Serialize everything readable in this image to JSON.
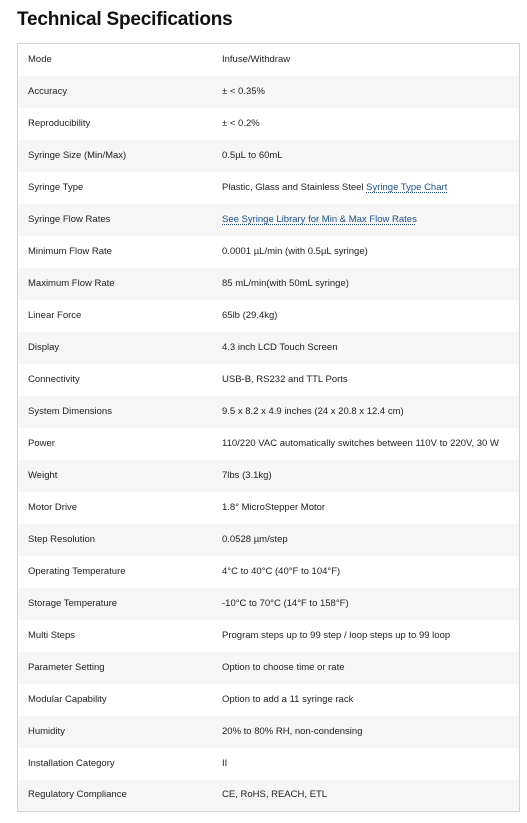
{
  "page": {
    "title": "Technical Specifications"
  },
  "colors": {
    "link": "#1b4f8a",
    "row_alt": "#f6f6f6",
    "border": "#d4d4d4"
  },
  "specs": [
    {
      "label": "Mode",
      "value": "Infuse/Withdraw"
    },
    {
      "label": "Accuracy",
      "value": "± < 0.35%"
    },
    {
      "label": "Reproducibility",
      "value": "± < 0.2%"
    },
    {
      "label": "Syringe Size (Min/Max)",
      "value": "0.5µL to 60mL"
    },
    {
      "label": "Syringe Type",
      "value": "Plastic, Glass and Stainless Steel ",
      "link": "Syringe Type Chart"
    },
    {
      "label": "Syringe Flow Rates",
      "value": "",
      "link": "See Syringe Library for Min & Max Flow Rates"
    },
    {
      "label": "Minimum Flow Rate",
      "value": "0.0001 µL/min (with 0.5µL syringe)"
    },
    {
      "label": "Maximum Flow Rate",
      "value": "85 mL/min(with 50mL syringe)"
    },
    {
      "label": "Linear Force",
      "value": "65lb (29.4kg)"
    },
    {
      "label": "Display",
      "value": "4.3 inch LCD Touch Screen"
    },
    {
      "label": "Connectivity",
      "value": "USB-B, RS232 and TTL Ports"
    },
    {
      "label": "System Dimensions",
      "value": "9.5 x 8.2 x 4.9 inches (24 x 20.8 x 12.4 cm)"
    },
    {
      "label": "Power",
      "value": "110/220 VAC automatically switches between 110V to 220V, 30 W"
    },
    {
      "label": "Weight",
      "value": "7lbs (3.1kg)"
    },
    {
      "label": "Motor Drive",
      "value": "1.8° MicroStepper Motor"
    },
    {
      "label": "Step Resolution",
      "value": "0.0528 µm/step"
    },
    {
      "label": "Operating Temperature",
      "value": "4°C to 40°C (40°F to 104°F)"
    },
    {
      "label": "Storage Temperature",
      "value": "-10°C to 70°C (14°F to 158°F)"
    },
    {
      "label": "Multi Steps",
      "value": "Program steps up to 99 step / loop steps up to 99 loop"
    },
    {
      "label": "Parameter Setting",
      "value": "Option to choose time or rate"
    },
    {
      "label": "Modular Capability",
      "value": "Option to add a 11 syringe rack"
    },
    {
      "label": "Humidity",
      "value": "20% to 80% RH, non-condensing"
    },
    {
      "label": "Installation Category",
      "value": "II"
    },
    {
      "label": "Regulatory Compliance",
      "value": "CE, RoHS, REACH, ETL"
    }
  ]
}
